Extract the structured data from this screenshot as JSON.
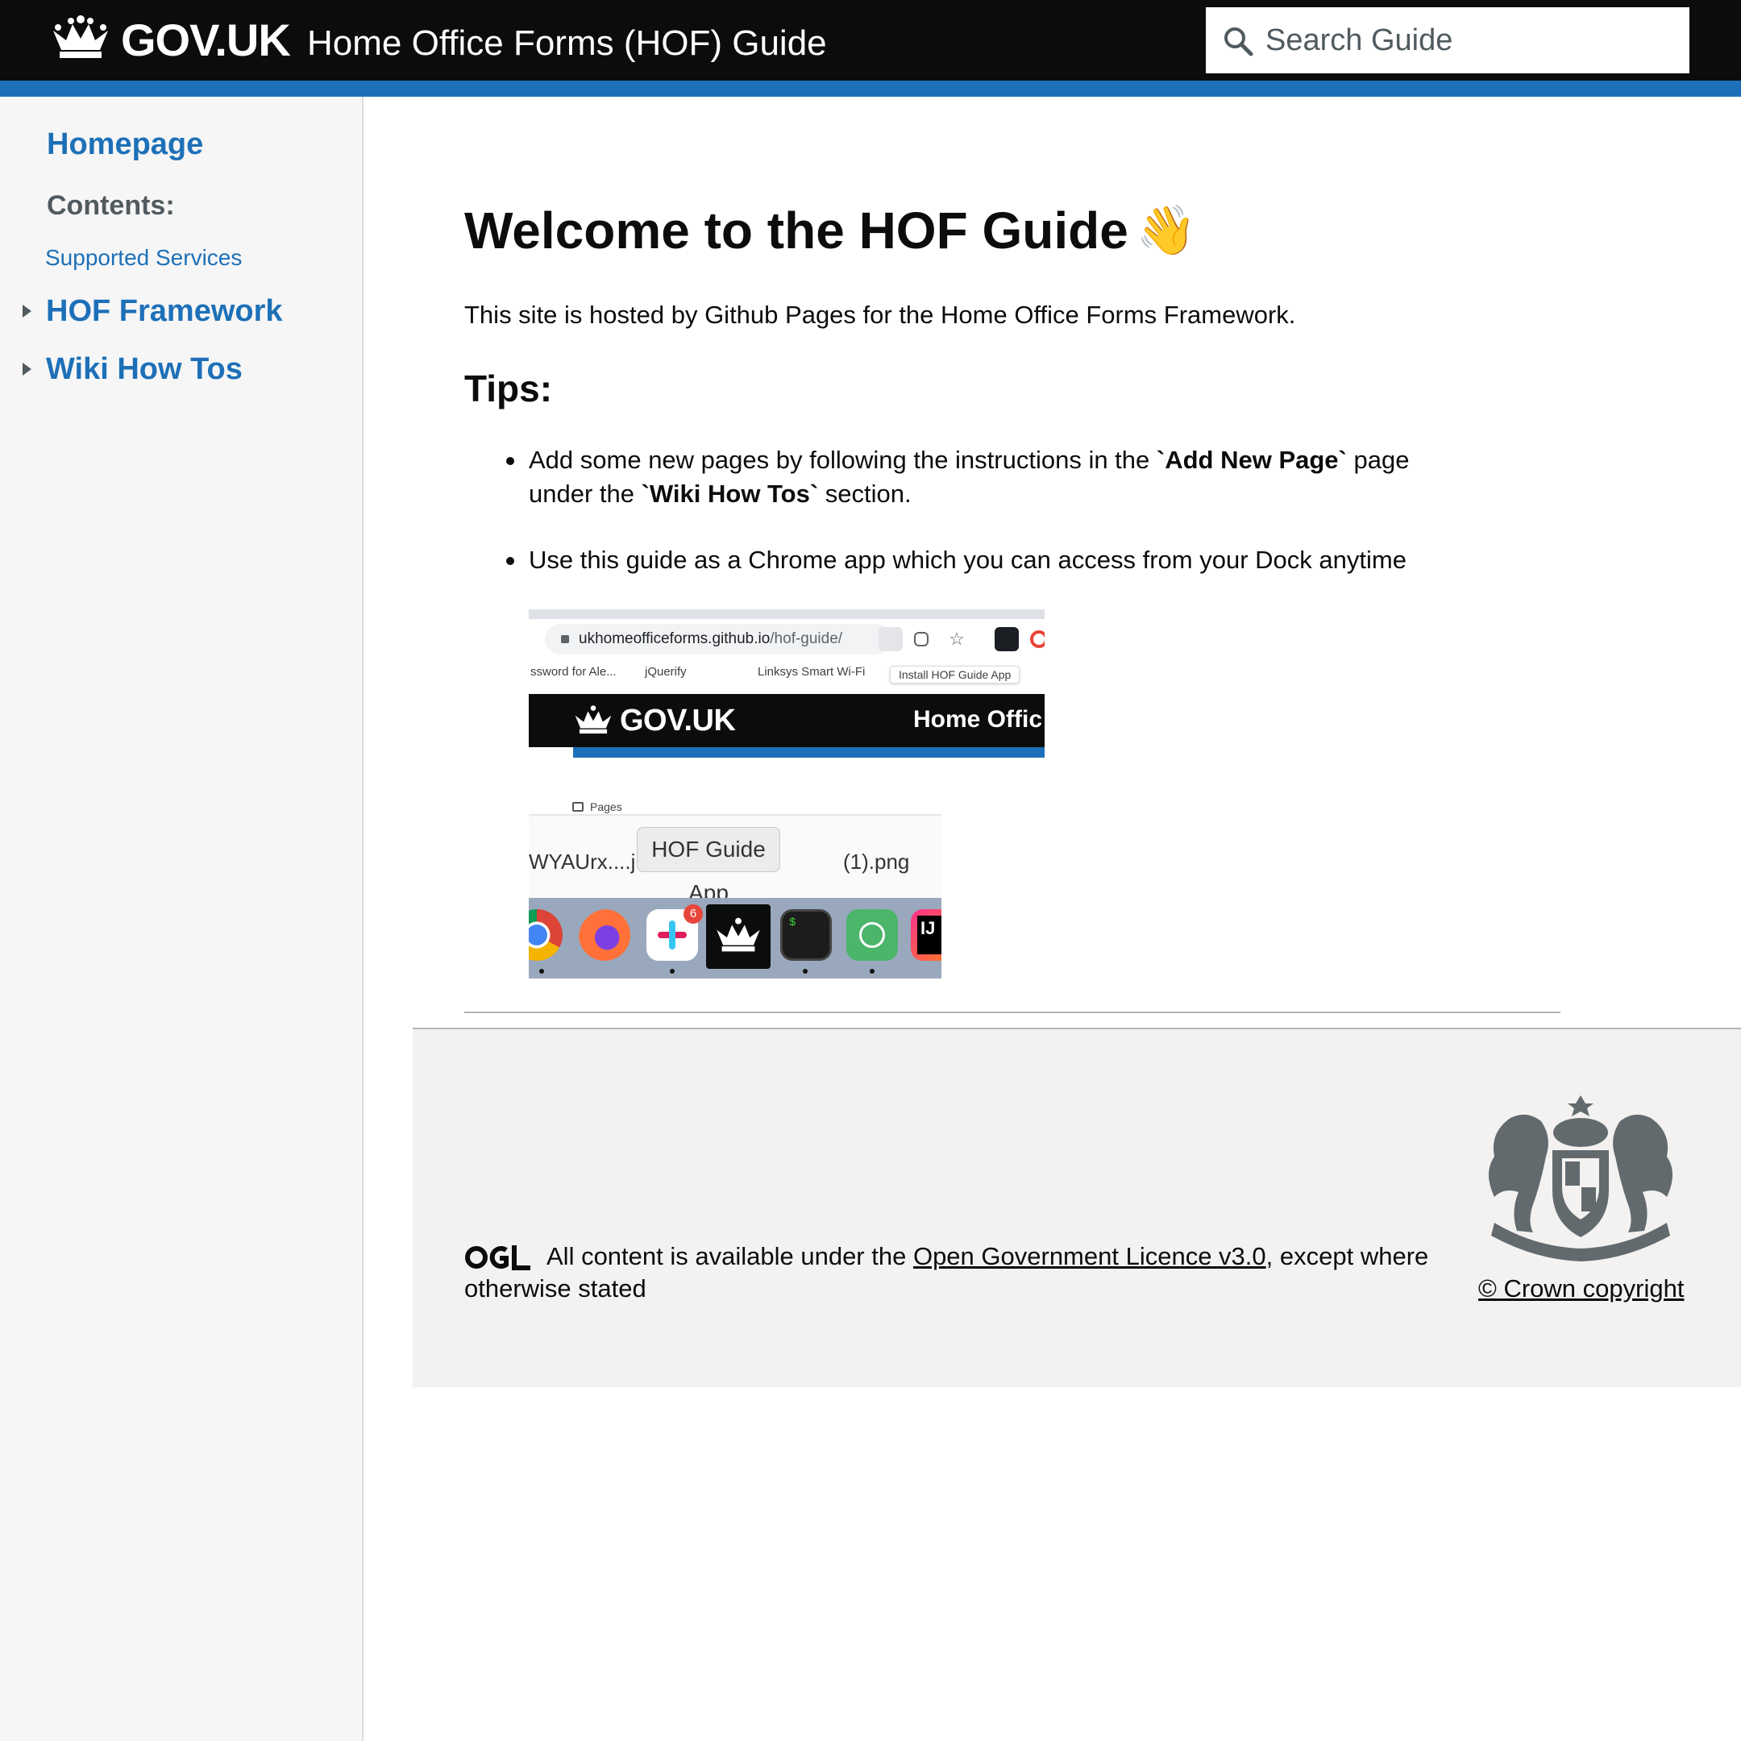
{
  "header": {
    "brand": "GOV.UK",
    "service_name": "Home Office Forms (HOF) Guide",
    "search_placeholder": "Search Guide"
  },
  "sidebar": {
    "home": "Homepage",
    "contents_label": "Contents:",
    "items": [
      {
        "label": "Supported Services"
      },
      {
        "label": "HOF Framework"
      },
      {
        "label": "Wiki How Tos"
      }
    ]
  },
  "main": {
    "title": "Welcome to the HOF Guide",
    "title_emoji": "👋",
    "intro": "This site is hosted by Github Pages for the Home Office Forms Framework.",
    "tips_heading": "Tips:",
    "tips": {
      "tip1_a": "Add some new pages by following the instructions in the ",
      "tip1_b": "`Add New Page`",
      "tip1_c": " page under the ",
      "tip1_d": "`Wiki How Tos`",
      "tip1_e": " section.",
      "tip2": "Use this guide as a Chrome app which you can access from your Dock anytime"
    },
    "screenshot": {
      "url_host": "ukhomeofficeforms.github.io",
      "url_path": "/hof-guide/",
      "bookmarks": [
        "ssword for Ale...",
        "jQuerify",
        "Linksys Smart Wi-Fi"
      ],
      "install_tooltip": "Install HOF Guide App",
      "gov_brand": "GOV.UK",
      "gov_service": "Home Offic",
      "pages_label": "Pages",
      "file1": "WYAUrx....j",
      "file2": "(1).png",
      "dock_tooltip": "HOF Guide App",
      "slack_badge": "6"
    }
  },
  "footer": {
    "licence_prefix": "All content is available under the ",
    "licence_link": "Open Government Licence v3.0",
    "licence_suffix": ", except where otherwise stated",
    "copyright": "© Crown copyright"
  },
  "colors": {
    "header_bg": "#0b0c0c",
    "brand_blue": "#1d70b8",
    "sidebar_bg": "#f6f6f6",
    "footer_bg": "#f3f2f1",
    "crest_grey": "#626a6e"
  }
}
